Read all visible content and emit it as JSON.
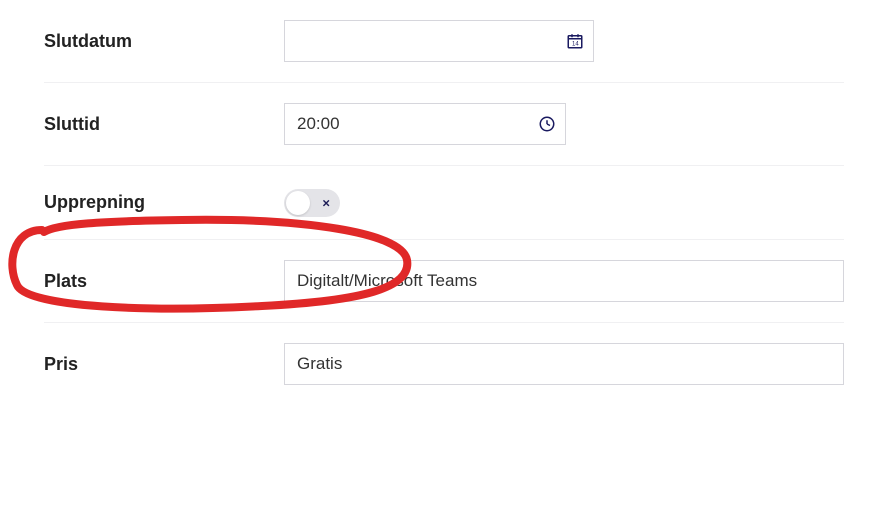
{
  "fields": {
    "end_date": {
      "label": "Slutdatum",
      "value": ""
    },
    "end_time": {
      "label": "Sluttid",
      "value": "20:00"
    },
    "repeat": {
      "label": "Upprepning",
      "on": false
    },
    "location": {
      "label": "Plats",
      "value": "Digitalt/Microsoft Teams"
    },
    "price": {
      "label": "Pris",
      "value": "Gratis"
    }
  },
  "icons": {
    "calendar": "calendar-icon",
    "clock": "clock-icon",
    "toggle_x": "×"
  },
  "annotation": {
    "color": "#e02828"
  }
}
